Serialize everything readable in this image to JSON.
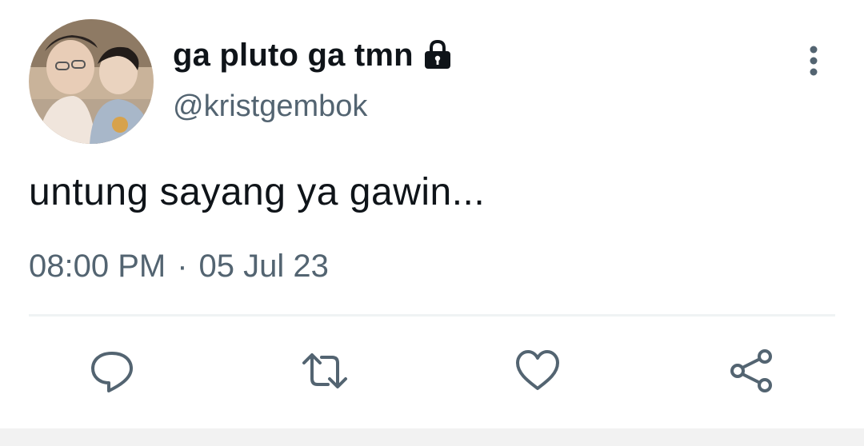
{
  "user": {
    "display_name": "ga pluto ga tmn",
    "handle": "@kristgembok",
    "protected_icon": "lock-icon",
    "avatar": "profile-photo"
  },
  "tweet": {
    "text": "untung sayang ya gawin...",
    "time": "08:00 PM",
    "separator": "·",
    "date": "05 Jul 23"
  },
  "actions": [
    {
      "name": "reply",
      "icon": "speech-bubble-icon"
    },
    {
      "name": "retweet",
      "icon": "retweet-arrows-icon"
    },
    {
      "name": "like",
      "icon": "heart-icon"
    },
    {
      "name": "share",
      "icon": "share-nodes-icon"
    }
  ],
  "menu": {
    "icon": "vertical-ellipsis-icon"
  },
  "colors": {
    "primary_text": "#0f1419",
    "secondary_text": "#536471",
    "divider": "#eff3f4"
  }
}
